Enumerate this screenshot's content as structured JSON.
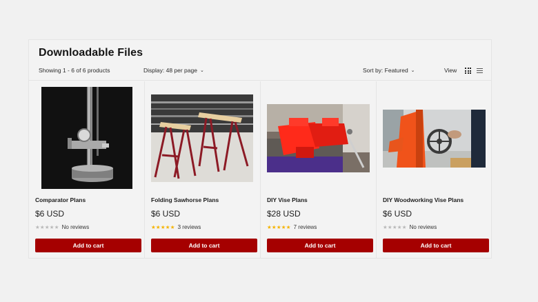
{
  "collection": {
    "title": "Downloadable Files",
    "count_text": "Showing 1 - 6 of 6 products",
    "display_text": "Display: 48 per page",
    "sort_text": "Sort by: Featured",
    "view_label": "View"
  },
  "products": [
    {
      "name": "Comparator Plans",
      "price": "$6 USD",
      "stars": "★★★★★",
      "reviews": "No reviews",
      "cart": "Add to cart"
    },
    {
      "name": "Folding Sawhorse Plans",
      "price": "$6 USD",
      "stars": "★★★★★",
      "reviews": "3 reviews",
      "cart": "Add to cart"
    },
    {
      "name": "DIY Vise Plans",
      "price": "$28 USD",
      "stars": "★★★★★",
      "reviews": "7 reviews",
      "cart": "Add to cart"
    },
    {
      "name": "DIY Woodworking Vise Plans",
      "price": "$6 USD",
      "stars": "★★★★★",
      "reviews": "No reviews",
      "cart": "Add to cart"
    }
  ],
  "colors": {
    "accent": "#a50000",
    "star": "#f5b400",
    "background": "#f1f1f1"
  }
}
